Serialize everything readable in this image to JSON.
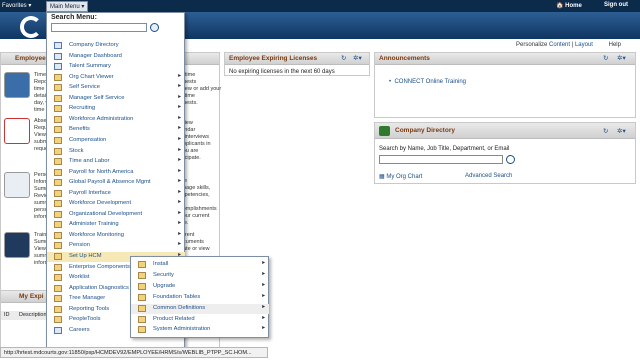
{
  "topbar": {
    "favorites": "Favorites ▾",
    "main_menu": "Main Menu ▾",
    "home": "🏠 Home",
    "sign_out": "Sign out"
  },
  "personalize": {
    "label": "Personalize",
    "content": "Content",
    "sep": " | ",
    "layout": "Layout",
    "help": "Help"
  },
  "left_pagelet": {
    "title": "Employee Self Service"
  },
  "tiles": [
    {
      "text": "Time\nRepo\ntime a\ndetail\nday, w\ntime r"
    },
    {
      "text": "Abse\nRequ\nView\nsubmi\nreque"
    },
    {
      "text": "Perso\nInform\nSumm\nReview\nsumm\nperso\ninform"
    },
    {
      "text": "Traini\nSumm\nView\nsumm\ninform"
    }
  ],
  "right_texts": [
    {
      "text": "ertime\nquests\nView or add your\ne time\nquests."
    },
    {
      "text": "rview\nlendar\ne interviews\napplicants in\nyou are\nrticipate."
    },
    {
      "text": "file\nanage skills,\nmpetencies,\n,\ncomplishments\nyour current\nfile."
    },
    {
      "text": "urrent\nocuments\ndate or view\nr"
    }
  ],
  "my_expiring": {
    "title": "My Expi",
    "col_id": "ID",
    "col_desc": "Description"
  },
  "licenses": {
    "title": "Employee Expiring Licenses",
    "body": "No expiring licenses in the next 60 days"
  },
  "announcements": {
    "title": "Announcements",
    "item": "CONNECT Online Training"
  },
  "company_directory": {
    "title": "Company Directory",
    "prompt": "Search by Name, Job Title, Department, or Email",
    "my_org_chart": "My Org Chart",
    "advanced": "Advanced Search"
  },
  "menu": {
    "title": "Search Menu:",
    "items": [
      {
        "label": "Company Directory",
        "icon": "doc",
        "arrow": ""
      },
      {
        "label": "Manager Dashboard",
        "icon": "doc",
        "arrow": ""
      },
      {
        "label": "Talent Summary",
        "icon": "doc",
        "arrow": ""
      },
      {
        "label": "Org Chart Viewer",
        "icon": "folder",
        "arrow": "▸"
      },
      {
        "label": "Self Service",
        "icon": "folder",
        "arrow": "▸"
      },
      {
        "label": "Manager Self Service",
        "icon": "folder",
        "arrow": "▸"
      },
      {
        "label": "Recruiting",
        "icon": "folder",
        "arrow": "▸"
      },
      {
        "label": "Workforce Administration",
        "icon": "folder",
        "arrow": "▸"
      },
      {
        "label": "Benefits",
        "icon": "folder",
        "arrow": "▸"
      },
      {
        "label": "Compensation",
        "icon": "folder",
        "arrow": "▸"
      },
      {
        "label": "Stock",
        "icon": "folder",
        "arrow": "▸"
      },
      {
        "label": "Time and Labor",
        "icon": "folder",
        "arrow": "▸"
      },
      {
        "label": "Payroll for North America",
        "icon": "folder",
        "arrow": "▸"
      },
      {
        "label": "Global Payroll & Absence Mgmt",
        "icon": "folder",
        "arrow": "▸"
      },
      {
        "label": "Payroll Interface",
        "icon": "folder",
        "arrow": "▸"
      },
      {
        "label": "Workforce Development",
        "icon": "folder",
        "arrow": "▸"
      },
      {
        "label": "Organizational Development",
        "icon": "folder",
        "arrow": "▸"
      },
      {
        "label": "Administer Training",
        "icon": "folder",
        "arrow": "▸"
      },
      {
        "label": "Workforce Monitoring",
        "icon": "folder",
        "arrow": "▸"
      },
      {
        "label": "Pension",
        "icon": "folder",
        "arrow": "▸"
      },
      {
        "label": "Set Up HCM",
        "icon": "folder",
        "arrow": "▸"
      },
      {
        "label": "Enterprise Components",
        "icon": "folder",
        "arrow": "▸"
      },
      {
        "label": "Worklist",
        "icon": "folder",
        "arrow": "▸"
      },
      {
        "label": "Application Diagnostics",
        "icon": "folder",
        "arrow": "▸"
      },
      {
        "label": "Tree Manager",
        "icon": "folder",
        "arrow": "▸"
      },
      {
        "label": "Reporting Tools",
        "icon": "folder",
        "arrow": "▸"
      },
      {
        "label": "PeopleTools",
        "icon": "folder",
        "arrow": "▸"
      },
      {
        "label": "Careers",
        "icon": "doc",
        "arrow": ""
      }
    ]
  },
  "submenu": {
    "items": [
      {
        "label": "Install",
        "arrow": "▸"
      },
      {
        "label": "Security",
        "arrow": "▸"
      },
      {
        "label": "Upgrade",
        "arrow": "▸"
      },
      {
        "label": "Foundation Tables",
        "arrow": "▸"
      },
      {
        "label": "Common Definitions",
        "arrow": "▸"
      },
      {
        "label": "Product Related",
        "arrow": "▸"
      },
      {
        "label": "System Administration",
        "arrow": "▸"
      }
    ]
  },
  "status_url": "http://hrtest.mdcourts.gov:11850/psp/HCMDEV92/EMPLOYEE/HRMS/s/WEBLIB_PTPP_SC.HOM..."
}
